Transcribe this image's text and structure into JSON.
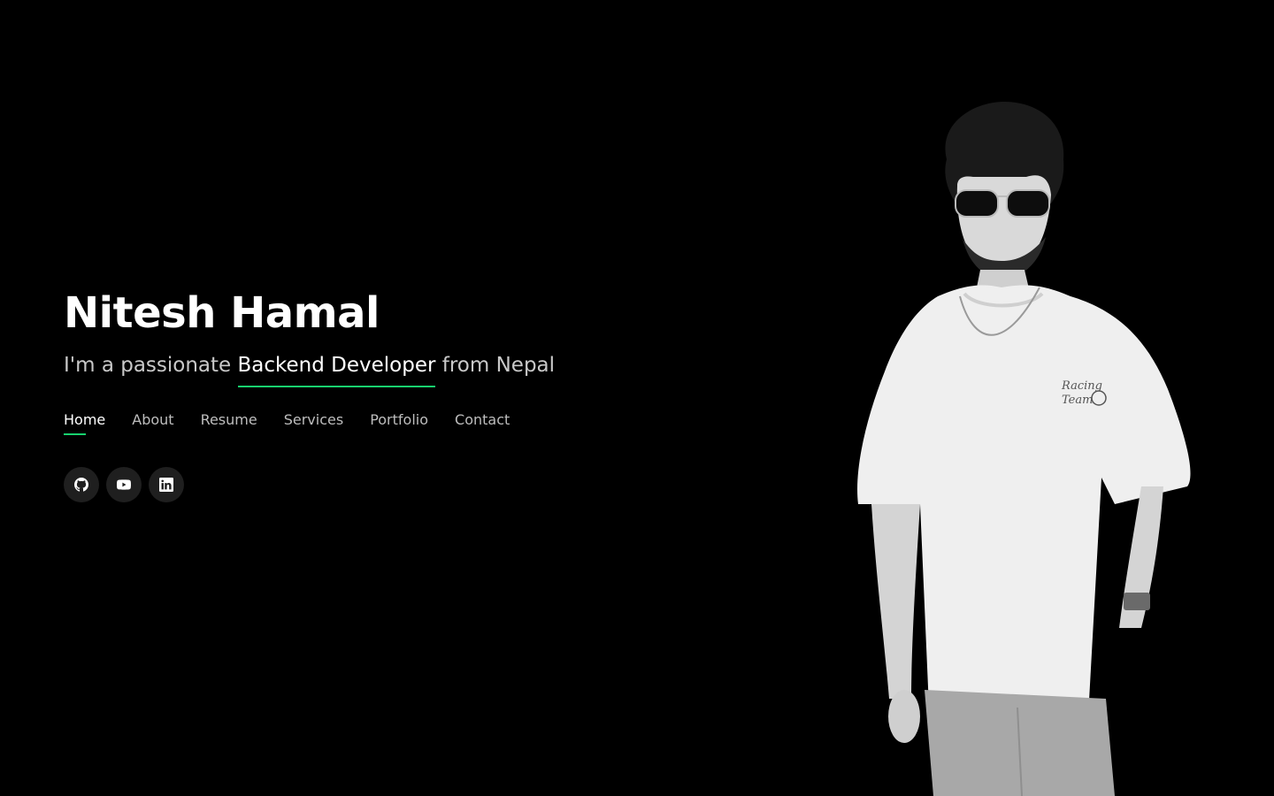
{
  "hero": {
    "name": "Nitesh Hamal",
    "tagline_prefix": "I'm a passionate ",
    "tagline_role": "Backend Developer",
    "tagline_suffix": " from Nepal"
  },
  "nav": {
    "items": [
      {
        "label": "Home",
        "active": true
      },
      {
        "label": "About",
        "active": false
      },
      {
        "label": "Resume",
        "active": false
      },
      {
        "label": "Services",
        "active": false
      },
      {
        "label": "Portfolio",
        "active": false
      },
      {
        "label": "Contact",
        "active": false
      }
    ]
  },
  "social": {
    "icons": [
      "github-icon",
      "youtube-icon",
      "linkedin-icon"
    ]
  },
  "colors": {
    "background": "#000000",
    "accent": "#18d26e",
    "nav_text": "#bdbdbd",
    "social_bg": "#1f1f1f"
  }
}
